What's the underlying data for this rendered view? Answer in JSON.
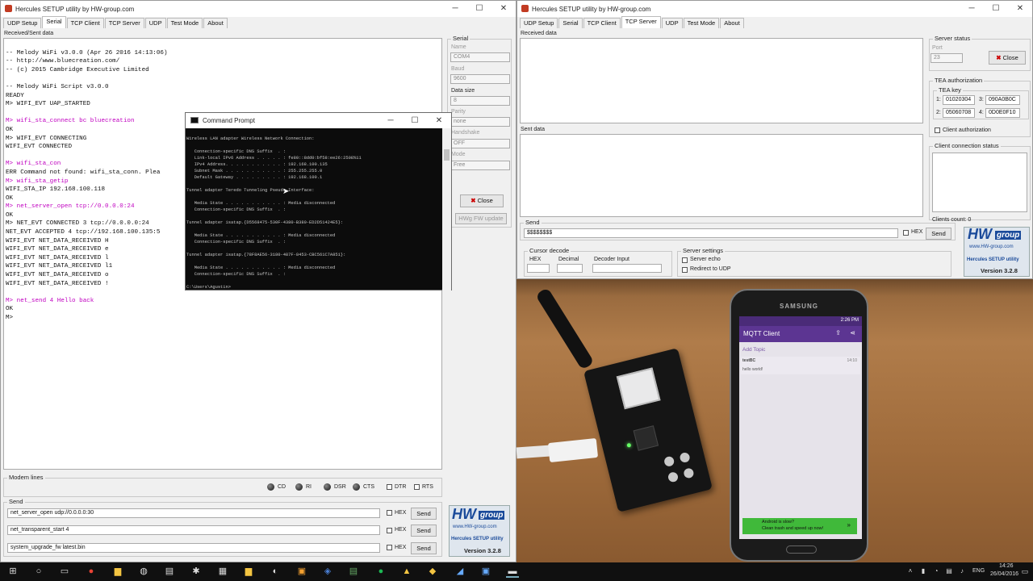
{
  "left_window": {
    "title": "Hercules SETUP utility by HW-group.com",
    "tabs": [
      "UDP Setup",
      "Serial",
      "TCP Client",
      "TCP Server",
      "UDP",
      "Test Mode",
      "About"
    ],
    "received_label": "Received/Sent data",
    "terminal_lines": [
      {
        "t": "",
        "c": "n"
      },
      {
        "t": "-- Melody WiFi v3.0.0 (Apr 26 2016 14:13:06)",
        "c": "n"
      },
      {
        "t": "-- http://www.bluecreation.com/",
        "c": "n"
      },
      {
        "t": "-- (c) 2015 Cambridge Executive Limited",
        "c": "n"
      },
      {
        "t": "",
        "c": "n"
      },
      {
        "t": "-- Melody WiFi Script v3.0.0",
        "c": "n"
      },
      {
        "t": "READY",
        "c": "n"
      },
      {
        "t": "M> WIFI_EVT UAP_STARTED",
        "c": "n"
      },
      {
        "t": "",
        "c": "n"
      },
      {
        "t": "M> wifi_sta_connect bc bluecreation",
        "c": "m"
      },
      {
        "t": "OK",
        "c": "n"
      },
      {
        "t": "M> WIFI_EVT CONNECTING",
        "c": "n"
      },
      {
        "t": "WIFI_EVT CONNECTED",
        "c": "n"
      },
      {
        "t": "",
        "c": "n"
      },
      {
        "t": "M> wifi_sta_con",
        "c": "m"
      },
      {
        "t": "ERR Command not found: wifi_sta_conn. Plea",
        "c": "n"
      },
      {
        "t": "M> wifi_sta_getip",
        "c": "m"
      },
      {
        "t": "WIFI_STA_IP 192.168.100.118",
        "c": "n"
      },
      {
        "t": "OK",
        "c": "n"
      },
      {
        "t": "M> net_server_open tcp://0.0.0.0:24",
        "c": "m"
      },
      {
        "t": "OK",
        "c": "n"
      },
      {
        "t": "M> NET_EVT CONNECTED 3 tcp://0.0.0.0:24",
        "c": "n"
      },
      {
        "t": "NET_EVT ACCEPTED 4 tcp://192.168.100.135:5",
        "c": "n"
      },
      {
        "t": "WIFI_EVT NET_DATA_RECEIVED H",
        "c": "n"
      },
      {
        "t": "WIFI_EVT NET_DATA_RECEIVED e",
        "c": "n"
      },
      {
        "t": "WIFI_EVT NET_DATA_RECEIVED l",
        "c": "n"
      },
      {
        "t": "WIFI_EVT NET_DATA_RECEIVED l1",
        "c": "n"
      },
      {
        "t": "WIFI_EVT NET_DATA_RECEIVED o",
        "c": "n"
      },
      {
        "t": "WIFI_EVT NET_DATA_RECEIVED !",
        "c": "n"
      },
      {
        "t": "",
        "c": "n"
      },
      {
        "t": "M> net_send 4 Hello back",
        "c": "m"
      },
      {
        "t": "OK",
        "c": "n"
      },
      {
        "t": "M>",
        "c": "n"
      }
    ],
    "serial": {
      "group": "Serial",
      "name_lbl": "Name",
      "name": "COM4",
      "baud_lbl": "Baud",
      "baud": "9600",
      "data_lbl": "Data size",
      "data": "8",
      "parity_lbl": "Parity",
      "parity": "none",
      "hand_lbl": "Handshake",
      "hand": "OFF",
      "mode_lbl": "Mode",
      "mode": "Free",
      "close": "Close",
      "fw": "HWg FW update"
    },
    "modem": {
      "label": "Modem lines",
      "cd": "CD",
      "ri": "RI",
      "dsr": "DSR",
      "cts": "CTS",
      "dtr": "DTR",
      "rts": "RTS"
    },
    "send": {
      "label": "Send",
      "rows": [
        {
          "value": "net_server_open udp://0.0.0.0:30"
        },
        {
          "value": "net_transparent_start 4"
        },
        {
          "value": "system_upgrade_fw latest.bin"
        }
      ],
      "hex": "HEX",
      "send": "Send"
    },
    "logo": {
      "brand": "HW",
      "group": "group",
      "url": "www.HW-group.com",
      "product": "Hercules SETUP utility",
      "version": "Version  3.2.8"
    }
  },
  "cmd_window": {
    "title": "Command Prompt",
    "lines": [
      "Wireless LAN adapter Wireless Network Connection:",
      "",
      "   Connection-specific DNS Suffix  . :",
      "   Link-local IPv6 Address . . . . . : fe80::8dd0:bf58:ee26:2508%11",
      "   IPv4 Address. . . . . . . . . . . : 192.168.100.135",
      "   Subnet Mask . . . . . . . . . . . : 255.255.255.0",
      "   Default Gateway . . . . . . . . . : 192.168.100.1",
      "",
      "Tunnel adapter Teredo Tunneling Pseudo-Interface:",
      "",
      "   Media State . . . . . . . . . . . : Media disconnected",
      "   Connection-specific DNS Suffix  . :",
      "",
      "Tunnel adapter isatap.{D5568475-530F-4380-B380-ED2D51424E5}:",
      "",
      "   Media State . . . . . . . . . . . : Media disconnected",
      "   Connection-specific DNS Suffix  . :",
      "",
      "Tunnel adapter isatap.{78F8AE56-3180-487F-8453-CBC561C7A851}:",
      "",
      "   Media State . . . . . . . . . . . : Media disconnected",
      "   Connection-specific DNS Suffix  . :",
      "",
      "C:\\Users\\Agustin>"
    ]
  },
  "right_window": {
    "title": "Hercules SETUP utility by HW-group.com",
    "tabs": [
      "UDP Setup",
      "Serial",
      "TCP Client",
      "TCP Server",
      "UDP",
      "Test Mode",
      "About"
    ],
    "received_label": "Received data",
    "sent_label": "Sent data",
    "server_status": {
      "label": "Server status",
      "port_lbl": "Port",
      "port": "23",
      "close": "Close"
    },
    "tea": {
      "label": "TEA authorization",
      "key_lbl": "TEA key",
      "k1": "01020304",
      "k2": "05060708",
      "k3": "090A0B0C",
      "k4": "0D0E0F10",
      "n1": "1:",
      "n2": "2:",
      "n3": "3:",
      "n4": "4:",
      "client_auth": "Client authorization"
    },
    "client_conn": {
      "label": "Client connection status",
      "count": "Clients count:  0"
    },
    "send": {
      "label": "Send",
      "value": "$$$$$$$$",
      "hex": "HEX",
      "send": "Send"
    },
    "cursor": {
      "label": "Cursor decode",
      "hex": "HEX",
      "dec": "Decimal",
      "dec_input": "Decoder Input"
    },
    "server_settings": {
      "label": "Server settings",
      "echo": "Server echo",
      "redirect": "Redirect to UDP"
    },
    "logo": {
      "brand": "HW",
      "group": "group",
      "url": "www.HW-group.com",
      "product": "Hercules SETUP utility",
      "version": "Version  3.2.8"
    }
  },
  "phone": {
    "brand": "SAMSUNG",
    "time": "2:26 PM",
    "app_title": "MQTT Client",
    "add_topic": "Add Topic",
    "topic": "testBC",
    "msg_time": "14:10",
    "message": "hello world!",
    "ad_line1": "Android is slow?",
    "ad_line2": "Clean trash and speed up now!"
  },
  "taskbar": {
    "lang": "ENG",
    "time": "14:26",
    "date": "26/04/2016"
  }
}
